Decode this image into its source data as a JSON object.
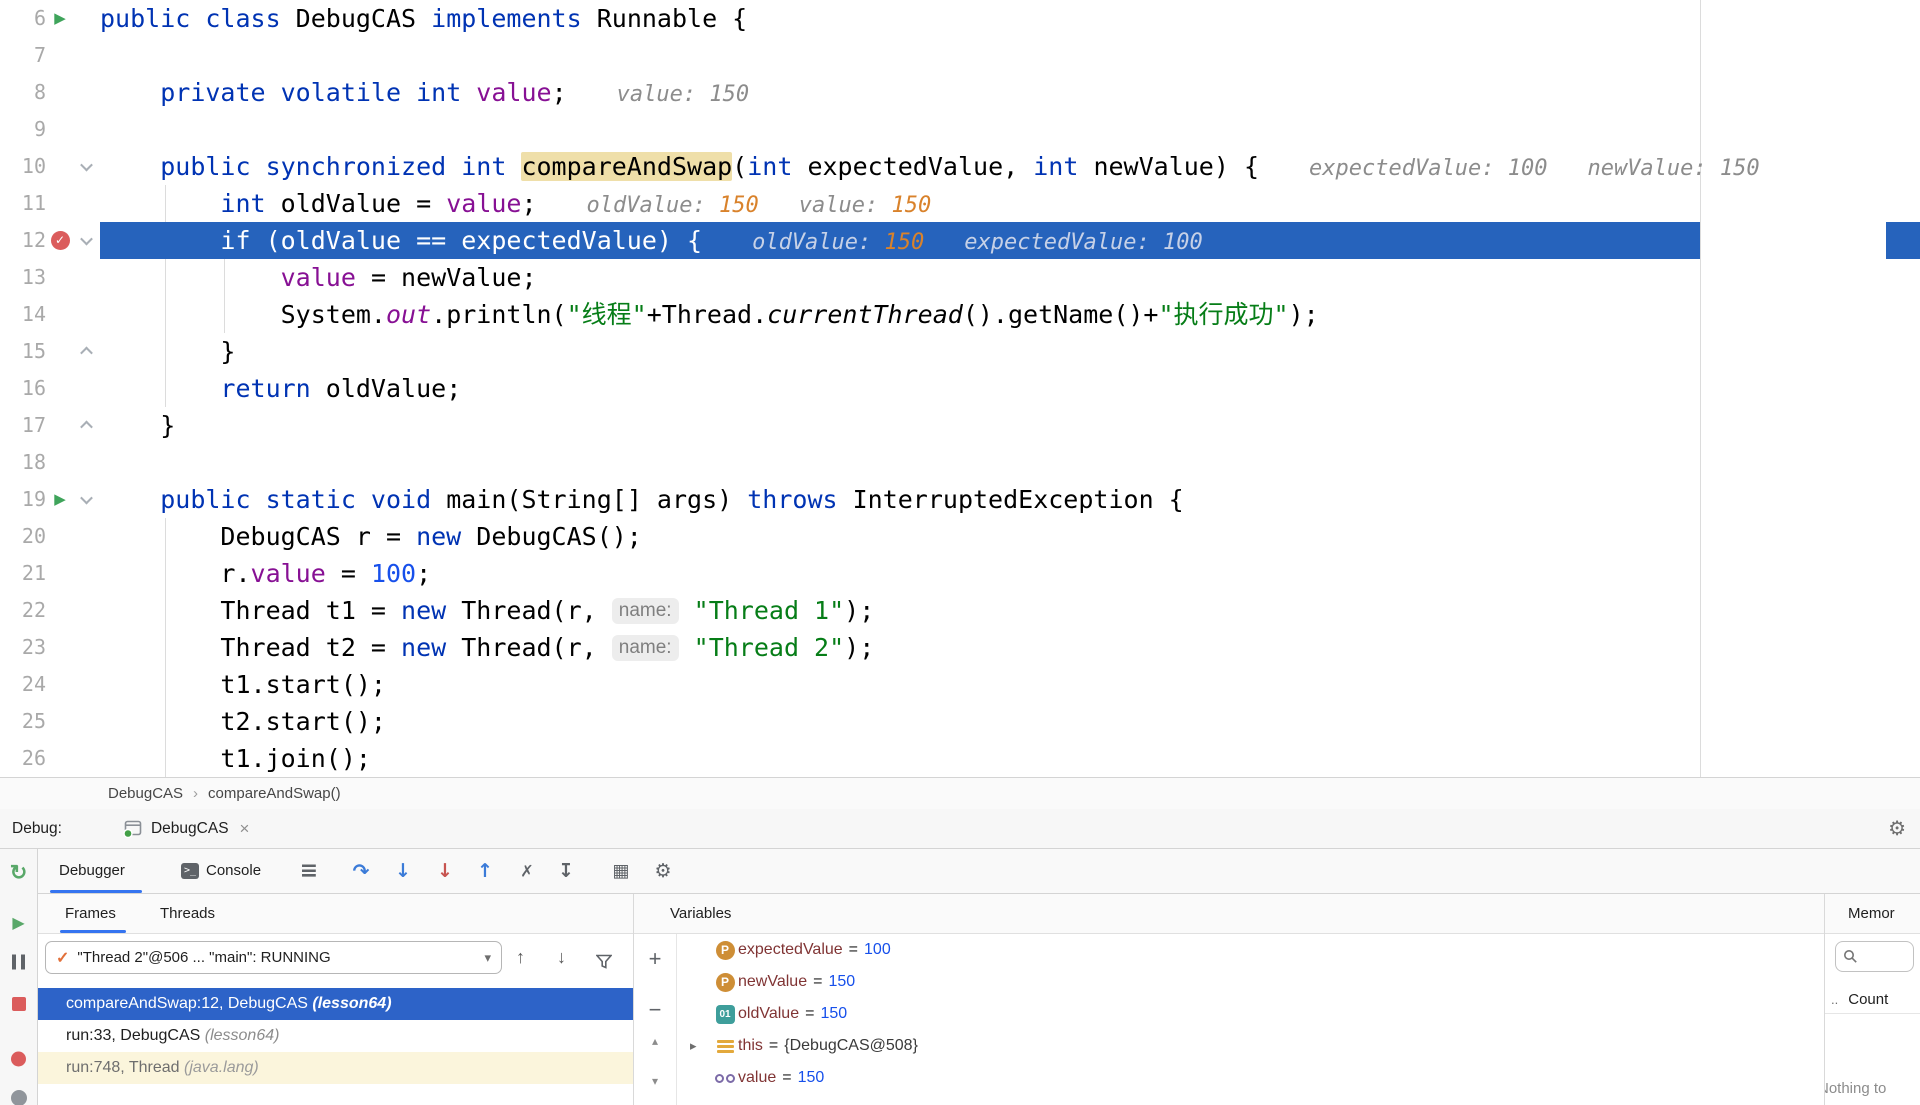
{
  "colors": {
    "accent_blue": "#3574F0",
    "execution_line_bg": "#2663BC",
    "selected_frame_bg": "#2D63C8",
    "breakpoint_red": "#DB5C5C",
    "hint_orange": "#D9822B",
    "keyword_blue": "#0033B3",
    "string_green": "#067D17",
    "field_purple": "#871094",
    "library_frame_bg": "#FBF5DC"
  },
  "editor": {
    "lines": [
      {
        "n": "6",
        "icon": "run",
        "code": [
          [
            "kw",
            "public class "
          ],
          [
            "pl",
            "DebugCAS "
          ],
          [
            "kw",
            "implements "
          ],
          [
            "pl",
            "Runnable {"
          ]
        ]
      },
      {
        "n": "7"
      },
      {
        "n": "8",
        "code": [
          [
            "pl",
            "    "
          ],
          [
            "kw",
            "private volatile int "
          ],
          [
            "fld",
            "value"
          ],
          [
            "pl",
            ";"
          ]
        ],
        "hints": [
          [
            [
              "h",
              "value: 150"
            ]
          ]
        ]
      },
      {
        "n": "9"
      },
      {
        "n": "10",
        "fold": "down",
        "code": [
          [
            "pl",
            "    "
          ],
          [
            "kw",
            "public synchronized int "
          ],
          [
            "hl",
            "compareAndSwap"
          ],
          [
            "pl",
            "("
          ],
          [
            "kw",
            "int "
          ],
          [
            "pl",
            "expectedValue, "
          ],
          [
            "kw",
            "int "
          ],
          [
            "pl",
            "newValue) {"
          ]
        ],
        "hints": [
          [
            [
              "h",
              "expectedValue: 100"
            ]
          ],
          [
            [
              "h",
              "newValue: 150"
            ]
          ]
        ]
      },
      {
        "n": "11",
        "code": [
          [
            "pl",
            "        "
          ],
          [
            "kw",
            "int "
          ],
          [
            "pl",
            "oldValue = "
          ],
          [
            "fld",
            "value"
          ],
          [
            "pl",
            ";"
          ]
        ],
        "hints": [
          [
            [
              "h",
              "oldValue: "
            ],
            [
              "hv",
              "150"
            ]
          ],
          [
            [
              "h",
              "value: "
            ],
            [
              "hv",
              "150"
            ]
          ]
        ]
      },
      {
        "n": "12",
        "current": true,
        "icon": "bp",
        "fold": "down",
        "code": [
          [
            "pl",
            "        "
          ],
          [
            "kw",
            "if "
          ],
          [
            "pl",
            "(oldValue == expectedValue) {"
          ]
        ],
        "hints": [
          [
            [
              "wh",
              "oldValue: "
            ],
            [
              "hv",
              "150"
            ]
          ],
          [
            [
              "wh",
              "expectedValue: 100"
            ]
          ]
        ]
      },
      {
        "n": "13",
        "code": [
          [
            "pl",
            "            "
          ],
          [
            "fld",
            "value"
          ],
          [
            "pl",
            " = newValue;"
          ]
        ]
      },
      {
        "n": "14",
        "code": [
          [
            "pl",
            "            System."
          ],
          [
            "stf",
            "out"
          ],
          [
            "pl",
            ".println("
          ],
          [
            "str",
            "\"线程\""
          ],
          [
            "pl",
            "+Thread."
          ],
          [
            "smi",
            "currentThread"
          ],
          [
            "pl",
            "().getName()+"
          ],
          [
            "str",
            "\"执行成功\""
          ],
          [
            "pl",
            ");"
          ]
        ]
      },
      {
        "n": "15",
        "fold": "up",
        "code": [
          [
            "pl",
            "        }"
          ]
        ]
      },
      {
        "n": "16",
        "code": [
          [
            "pl",
            "        "
          ],
          [
            "kw",
            "return "
          ],
          [
            "pl",
            "oldValue;"
          ]
        ]
      },
      {
        "n": "17",
        "fold": "up",
        "code": [
          [
            "pl",
            "    }"
          ]
        ]
      },
      {
        "n": "18"
      },
      {
        "n": "19",
        "icon": "run",
        "fold": "down",
        "code": [
          [
            "pl",
            "    "
          ],
          [
            "kw",
            "public static void "
          ],
          [
            "pl",
            "main(String[] args) "
          ],
          [
            "kw",
            "throws "
          ],
          [
            "pl",
            "InterruptedException {"
          ]
        ]
      },
      {
        "n": "20",
        "code": [
          [
            "pl",
            "        DebugCAS r = "
          ],
          [
            "kw",
            "new "
          ],
          [
            "pl",
            "DebugCAS();"
          ]
        ]
      },
      {
        "n": "21",
        "code": [
          [
            "pl",
            "        r."
          ],
          [
            "fld",
            "value"
          ],
          [
            "pl",
            " = "
          ],
          [
            "num",
            "100"
          ],
          [
            "pl",
            ";"
          ]
        ]
      },
      {
        "n": "22",
        "code": [
          [
            "pl",
            "        Thread t1 = "
          ],
          [
            "kw",
            "new "
          ],
          [
            "pl",
            "Thread(r, "
          ],
          [
            "chip",
            "name:"
          ],
          [
            "pl",
            " "
          ],
          [
            "str",
            "\"Thread 1\""
          ],
          [
            "pl",
            ");"
          ]
        ]
      },
      {
        "n": "23",
        "code": [
          [
            "pl",
            "        Thread t2 = "
          ],
          [
            "kw",
            "new "
          ],
          [
            "pl",
            "Thread(r, "
          ],
          [
            "chip",
            "name:"
          ],
          [
            "pl",
            " "
          ],
          [
            "str",
            "\"Thread 2\""
          ],
          [
            "pl",
            ");"
          ]
        ]
      },
      {
        "n": "24",
        "code": [
          [
            "pl",
            "        t1.start();"
          ]
        ]
      },
      {
        "n": "25",
        "code": [
          [
            "pl",
            "        t2.start();"
          ]
        ]
      },
      {
        "n": "26",
        "code": [
          [
            "pl",
            "        t1.join();"
          ]
        ]
      }
    ]
  },
  "breadcrumb": {
    "class_name": "DebugCAS",
    "separator": "›",
    "method_name": "compareAndSwap()"
  },
  "debug_header": {
    "label": "Debug:",
    "tab_label": "DebugCAS",
    "close": "×",
    "gear": "⚙"
  },
  "debug_toolbar": {
    "tabs": [
      {
        "label": "Debugger"
      },
      {
        "label": "Console"
      }
    ],
    "icons": [
      "menu",
      "step-over",
      "step-into",
      "force-step-into",
      "step-out",
      "drop-frame",
      "run-to-cursor",
      "grid",
      "settings"
    ]
  },
  "debug_left_toolbar": {
    "icons": [
      "rerun",
      "resume",
      "pause",
      "stop",
      "view-breakpoints",
      "mute-breakpoints"
    ]
  },
  "frames": {
    "tabs": [
      {
        "label": "Frames"
      },
      {
        "label": "Threads"
      }
    ],
    "thread_selector": "\"Thread 2\"@506 ... \"main\": RUNNING",
    "rows": [
      {
        "text": "compareAndSwap:12, DebugCAS ",
        "origin": "(lesson64)",
        "style": "selected"
      },
      {
        "text": "run:33, DebugCAS ",
        "origin": "(lesson64)",
        "style": "normal"
      },
      {
        "text": "run:748, Thread ",
        "origin": "(java.lang)",
        "style": "library"
      }
    ]
  },
  "variables": {
    "header": "Variables",
    "items": [
      {
        "icon": "parameter",
        "name": "expectedValue",
        "value": "100",
        "vtype": "num",
        "expandable": false
      },
      {
        "icon": "parameter",
        "name": "newValue",
        "value": "150",
        "vtype": "num",
        "expandable": false
      },
      {
        "icon": "local",
        "name": "oldValue",
        "value": "150",
        "vtype": "num",
        "expandable": false
      },
      {
        "icon": "object",
        "name": "this",
        "value": "{DebugCAS@508}",
        "vtype": "ref",
        "expandable": true
      },
      {
        "icon": "field",
        "name": "value",
        "value": "150",
        "vtype": "num",
        "expandable": false
      }
    ]
  },
  "memory": {
    "header": "Memor",
    "dots": "..",
    "count_label": "Count",
    "empty_text": "Nothing to"
  }
}
